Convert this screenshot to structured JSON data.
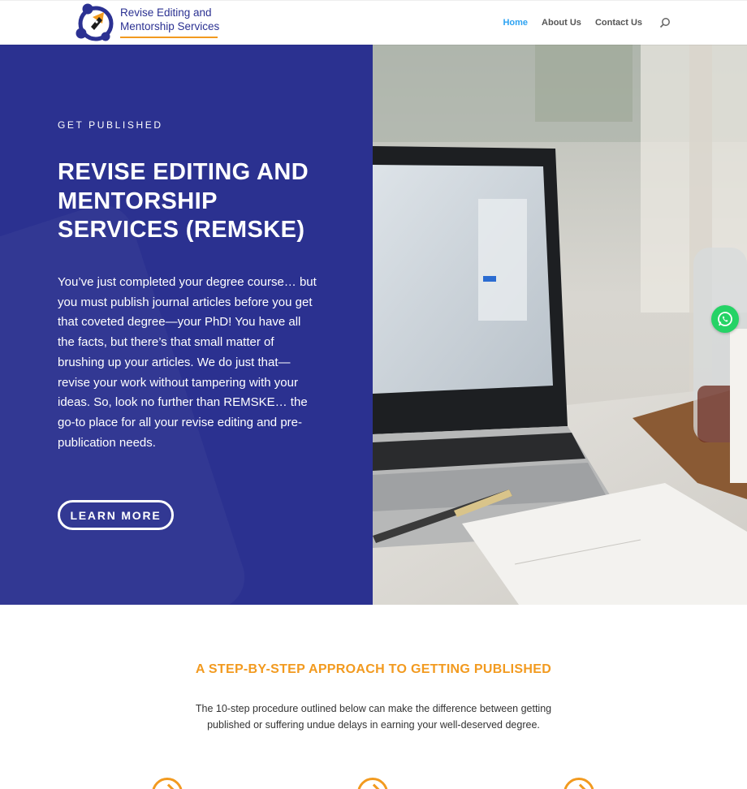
{
  "header": {
    "logo": {
      "line1": "Revise Editing  and",
      "line2": "Mentorship  Services",
      "icon": "pen-nib-circle-logo-icon"
    },
    "nav": [
      {
        "label": "Home",
        "active": true
      },
      {
        "label": "About Us",
        "active": false
      },
      {
        "label": "Contact Us",
        "active": false
      }
    ],
    "search_icon": "search-icon"
  },
  "hero": {
    "eyebrow": "GET PUBLISHED",
    "title": "REVISE EDITING AND MENTORSHIP SERVICES (REMSKE)",
    "body": "You’ve just completed your degree course… but you must publish journal articles before you get that coveted degree—your PhD! You have all the facts, but there’s that small matter of brushing up your articles. We do just that—revise your work without tampering with your ideas. So, look no further than REMSKE… the go-to place for all your revise editing and pre-publication needs.",
    "button_label": "LEARN MORE",
    "image_alt": "laptop-on-desk-photo"
  },
  "floating": {
    "whatsapp_icon": "whatsapp-icon"
  },
  "section": {
    "title": "A STEP-BY-STEP APPROACH TO GETTING PUBLISHED",
    "subtitle": "The 10-step procedure outlined below can make the difference between getting published or suffering undue delays in earning your well-deserved degree.",
    "step_icons": [
      "chevron-circle-icon",
      "chevron-circle-icon",
      "chevron-circle-icon"
    ]
  },
  "colors": {
    "brand_blue": "#2b3190",
    "accent_orange": "#f29a1f",
    "nav_active": "#2ea3f2",
    "whatsapp_green": "#25d366"
  }
}
